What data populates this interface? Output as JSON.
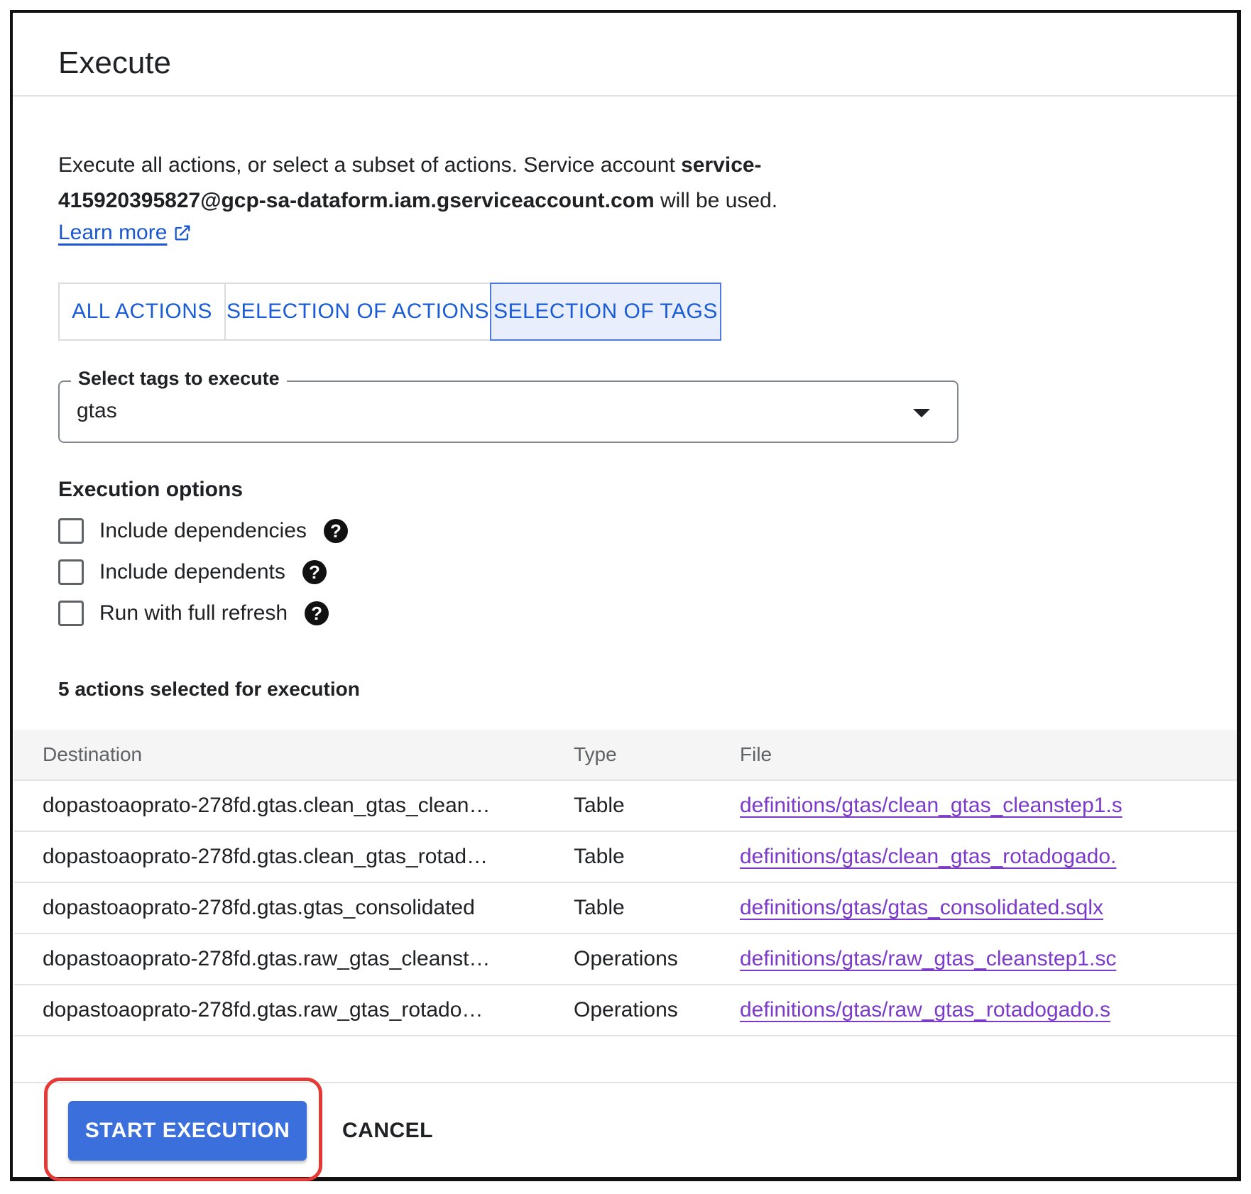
{
  "dialog": {
    "title": "Execute",
    "desc_text": "Execute all actions, or select a subset of actions. Service account ",
    "service_account": "service-415920395827@gcp-sa-dataform.iam.gserviceaccount.com",
    "desc_suffix": " will be used.",
    "learn_more": "Learn more"
  },
  "tabs": [
    {
      "label": "ALL ACTIONS",
      "active": false
    },
    {
      "label": "SELECTION OF ACTIONS",
      "active": false
    },
    {
      "label": "SELECTION OF TAGS",
      "active": true
    }
  ],
  "tag_select": {
    "label": "Select tags to execute",
    "value": "gtas"
  },
  "options": {
    "heading": "Execution options",
    "items": [
      {
        "label": "Include dependencies",
        "checked": false
      },
      {
        "label": "Include dependents",
        "checked": false
      },
      {
        "label": "Run with full refresh",
        "checked": false
      }
    ],
    "help_icon": "?"
  },
  "selected_count": "5 actions selected for execution",
  "table": {
    "headers": [
      "Destination",
      "Type",
      "File"
    ],
    "rows": [
      {
        "destination": "dopastoaoprato-278fd.gtas.clean_gtas_clean…",
        "type": "Table",
        "file": "definitions/gtas/clean_gtas_cleanstep1.s"
      },
      {
        "destination": "dopastoaoprato-278fd.gtas.clean_gtas_rotad…",
        "type": "Table",
        "file": "definitions/gtas/clean_gtas_rotadogado."
      },
      {
        "destination": "dopastoaoprato-278fd.gtas.gtas_consolidated",
        "type": "Table",
        "file": "definitions/gtas/gtas_consolidated.sqlx"
      },
      {
        "destination": "dopastoaoprato-278fd.gtas.raw_gtas_cleanst…",
        "type": "Operations",
        "file": "definitions/gtas/raw_gtas_cleanstep1.sc"
      },
      {
        "destination": "dopastoaoprato-278fd.gtas.raw_gtas_rotado…",
        "type": "Operations",
        "file": "definitions/gtas/raw_gtas_rotadogado.s"
      }
    ]
  },
  "footer": {
    "primary": "START EXECUTION",
    "secondary": "CANCEL"
  },
  "colors": {
    "accent": "#3b6fdb",
    "link": "#1a57d0",
    "file_link": "#7b3ac8",
    "highlight": "#e53935"
  }
}
